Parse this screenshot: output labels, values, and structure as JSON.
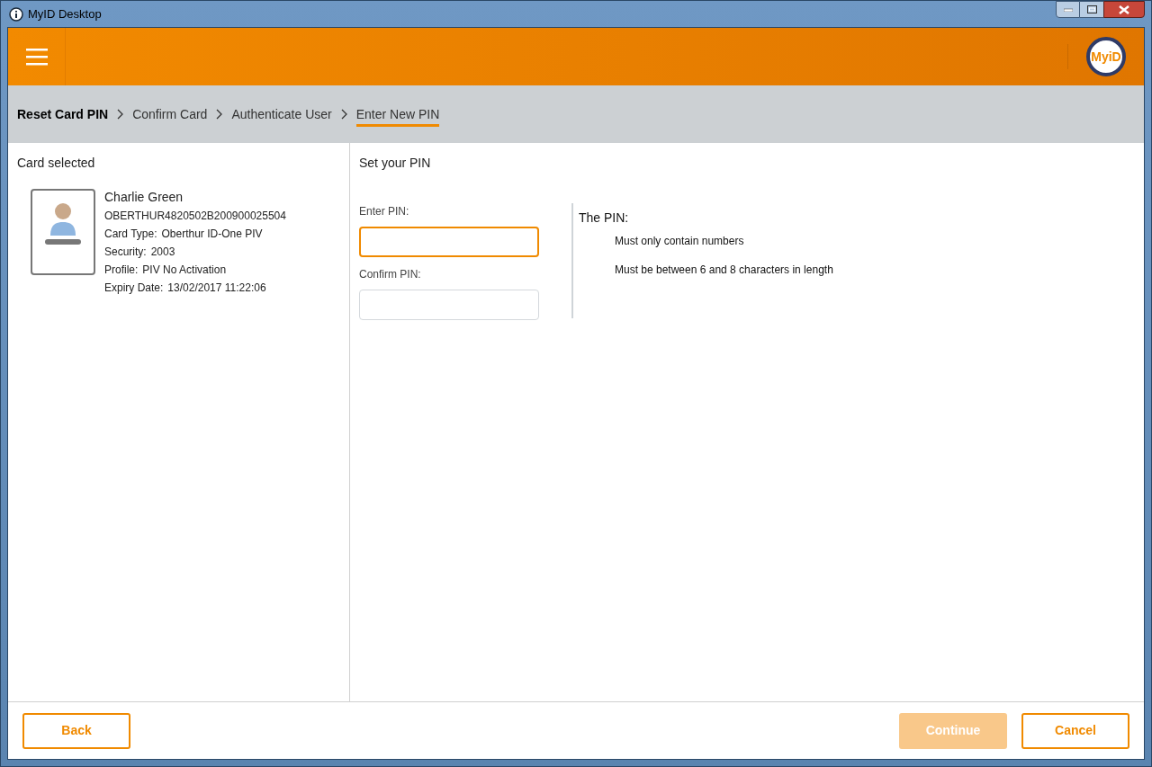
{
  "window": {
    "title": "MyID Desktop"
  },
  "header": {
    "logo": "MyiD"
  },
  "breadcrumb": [
    {
      "label": "Reset Card PIN",
      "kind": "title",
      "selected": false
    },
    {
      "label": "Confirm Card",
      "kind": "step",
      "selected": false
    },
    {
      "label": "Authenticate User",
      "kind": "step",
      "selected": false
    },
    {
      "label": "Enter New PIN",
      "kind": "step",
      "selected": true
    }
  ],
  "card_panel": {
    "heading": "Card selected",
    "name": "Charlie Green",
    "card_id": "OBERTHUR4820502B200900025504",
    "details": [
      {
        "label": "Card Type:",
        "value": "Oberthur ID-One PIV"
      },
      {
        "label": "Security:",
        "value": "2003"
      },
      {
        "label": "Profile:",
        "value": "PIV No Activation"
      },
      {
        "label": "Expiry Date:",
        "value": "13/02/2017 11:22:06"
      }
    ]
  },
  "pin_form": {
    "heading": "Set your PIN",
    "fields": [
      {
        "label": "Enter PIN:",
        "focused": true
      },
      {
        "label": "Confirm PIN:",
        "focused": false
      }
    ],
    "rules": {
      "heading": "The PIN:",
      "items": [
        "Must only contain numbers",
        "Must be between 6 and 8 characters in length"
      ]
    }
  },
  "footer": {
    "left_buttons": [
      {
        "label": "Back",
        "disabled": false
      }
    ],
    "right_buttons": [
      {
        "label": "Continue",
        "disabled": true
      },
      {
        "label": "Cancel",
        "disabled": false
      }
    ]
  }
}
